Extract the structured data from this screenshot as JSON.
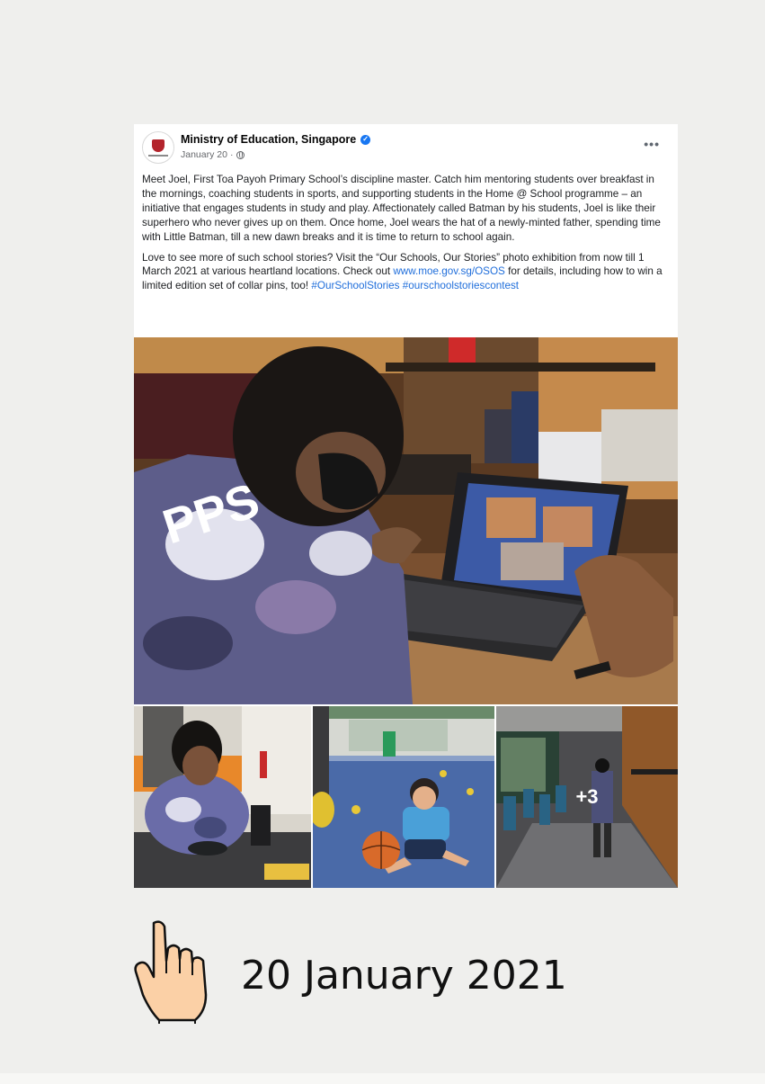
{
  "post": {
    "author": "Ministry of Education, Singapore",
    "date": "January 20",
    "date_separator": "·",
    "more_label": "•••",
    "paragraph1": "Meet Joel, First Toa Payoh Primary School’s discipline master. Catch him mentoring students over breakfast in the mornings, coaching students in sports, and supporting students in the Home @ School programme – an initiative that engages students in study and play. Affectionately called Batman by his students, Joel is like their superhero who never gives up on them. Once home, Joel wears the hat of a newly-minted father, spending time with Little Batman, till a new dawn breaks and it is time to return to school again.",
    "paragraph2_part1": "Love to see more of such school stories? Visit the “Our Schools, Our Stories” photo exhibition from now till 1 March 2021 at various heartland locations. Check out ",
    "paragraph2_link": "www.moe.gov.sg/OSOS",
    "paragraph2_part2": " for details, including how to win a limited edition set of collar pins, too! ",
    "hashtag1": "#OurSchoolStories",
    "hashtag2": "#ourschoolstoriescontest",
    "more_photos_label": "+3"
  },
  "footer": {
    "date_label": "20 January 2021"
  },
  "colors": {
    "link": "#216fdb",
    "verified": "#1877f2",
    "background": "#efefed"
  },
  "icons": [
    "verified-badge-icon",
    "globe-icon",
    "more-options-icon",
    "pointing-hand-icon"
  ]
}
